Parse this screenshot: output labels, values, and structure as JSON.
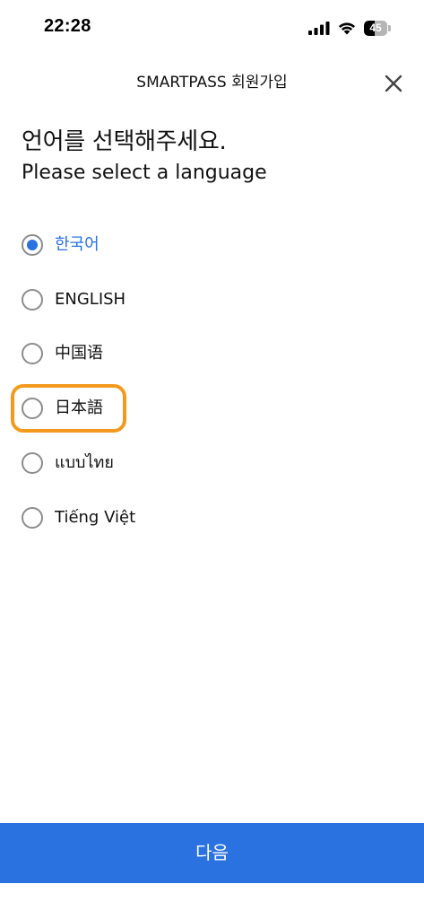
{
  "status_bar": {
    "time": "22:28",
    "battery_level": "45",
    "battery_fraction": 0.45,
    "icons": [
      "signal-icon",
      "wifi-icon",
      "battery-icon"
    ]
  },
  "header": {
    "title": "SMARTPASS 회원가입",
    "close_icon": "close-icon"
  },
  "heading": {
    "primary": "언어를 선택해주세요.",
    "secondary": "Please select a language"
  },
  "languages": [
    {
      "label": "한국어",
      "selected": true
    },
    {
      "label": "ENGLISH",
      "selected": false
    },
    {
      "label": "中国语",
      "selected": false
    },
    {
      "label": "日本語",
      "selected": false,
      "highlighted": true
    },
    {
      "label": "แบบไทย",
      "selected": false
    },
    {
      "label": "Tiếng Việt",
      "selected": false
    }
  ],
  "next_button": {
    "label": "다음"
  },
  "colors": {
    "accent": "#2a72e0",
    "highlight": "#f39a1e",
    "radio_border": "#8c8c8c",
    "text": "#111111"
  }
}
